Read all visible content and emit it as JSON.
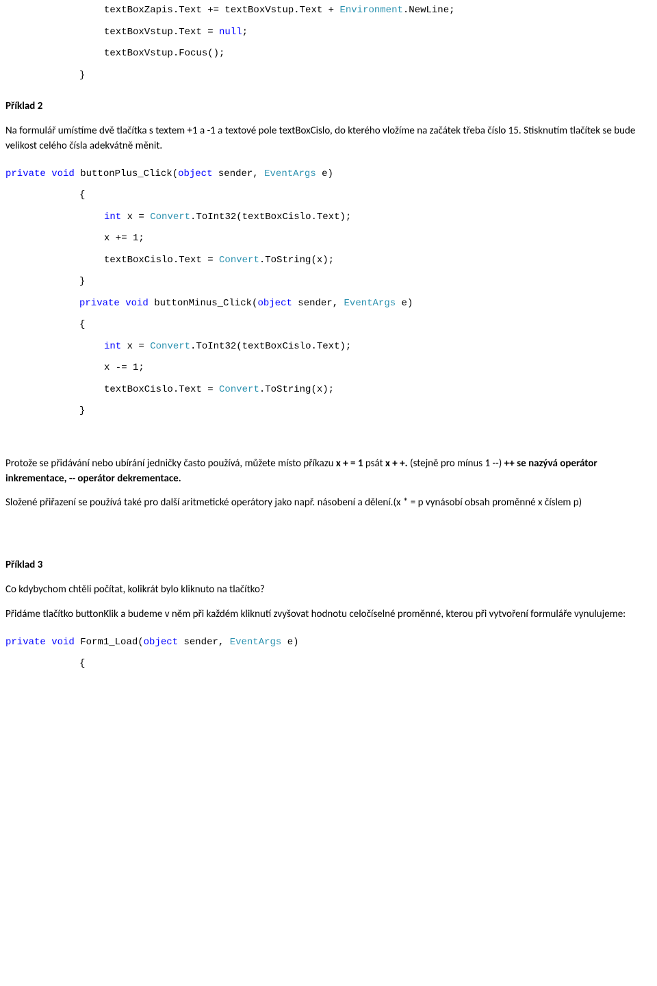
{
  "code_top": {
    "l1a": "textBoxZapis.Text += textBoxVstup.Text + ",
    "l1b": "Environment",
    "l1c": ".NewLine;",
    "l2": "textBoxVstup.Text = ",
    "l2b": "null",
    "l2c": ";",
    "l3": "textBoxVstup.Focus();",
    "l4": "}"
  },
  "ex2": {
    "heading": "Příklad 2",
    "para": "Na formulář umístíme dvě tlačítka s textem +1 a -1 a textové pole textBoxCislo, do kterého vložíme na začátek třeba číslo 15. Stisknutím tlačítek se bude velikost celého čísla adekvátně měnit.",
    "plus": {
      "sig_a": "private",
      "sig_b": " ",
      "sig_c": "void",
      "sig_d": " buttonPlus_Click(",
      "sig_e": "object",
      "sig_f": " sender, ",
      "sig_g": "EventArgs",
      "sig_h": " e)",
      "brace_open": "{",
      "l1a": "int",
      "l1b": " x = ",
      "l1c": "Convert",
      "l1d": ".ToInt32(textBoxCislo.Text);",
      "l2": "x += 1;",
      "l3a": "textBoxCislo.Text = ",
      "l3b": "Convert",
      "l3c": ".ToString(x);",
      "brace_close": "}"
    },
    "minus": {
      "sig_a": "private",
      "sig_c": "void",
      "sig_d": " buttonMinus_Click(",
      "sig_e": "object",
      "sig_f": " sender, ",
      "sig_g": "EventArgs",
      "sig_h": " e)",
      "brace_open": "{",
      "l1a": "int",
      "l1b": " x = ",
      "l1c": "Convert",
      "l1d": ".ToInt32(textBoxCislo.Text);",
      "l2": "x -= 1;",
      "l3a": "textBoxCislo.Text = ",
      "l3b": "Convert",
      "l3c": ".ToString(x);",
      "brace_close": "}"
    }
  },
  "middle": {
    "p1a": "Protože se přidávání nebo ubírání jedničky často používá, můžete místo příkazu ",
    "p1b": "x + = 1",
    "p1c": " psát ",
    "p1d": "x + +.",
    "p1e": " (stejně pro mínus 1 --) ",
    "p1f": "++ se nazývá operátor inkrementace, -- operátor dekrementace.",
    "p2": "Složené přiřazení se používá také pro další aritmetické operátory jako např. násobení a dělení.(x * = p vynásobí obsah proměnné x číslem p)"
  },
  "ex3": {
    "heading": "Příklad 3",
    "p1": "Co kdybychom chtěli počítat, kolikrát bylo kliknuto na tlačítko?",
    "p2": "Přidáme tlačítko buttonKlik a budeme v něm při každém kliknutí zvyšovat hodnotu celočíselné proměnné, kterou při vytvoření formuláře vynulujeme:",
    "sig_a": "private",
    "sig_c": "void",
    "sig_d": " Form1_Load(",
    "sig_e": "object",
    "sig_f": " sender, ",
    "sig_g": "EventArgs",
    "sig_h": " e)",
    "brace_open": "{"
  }
}
